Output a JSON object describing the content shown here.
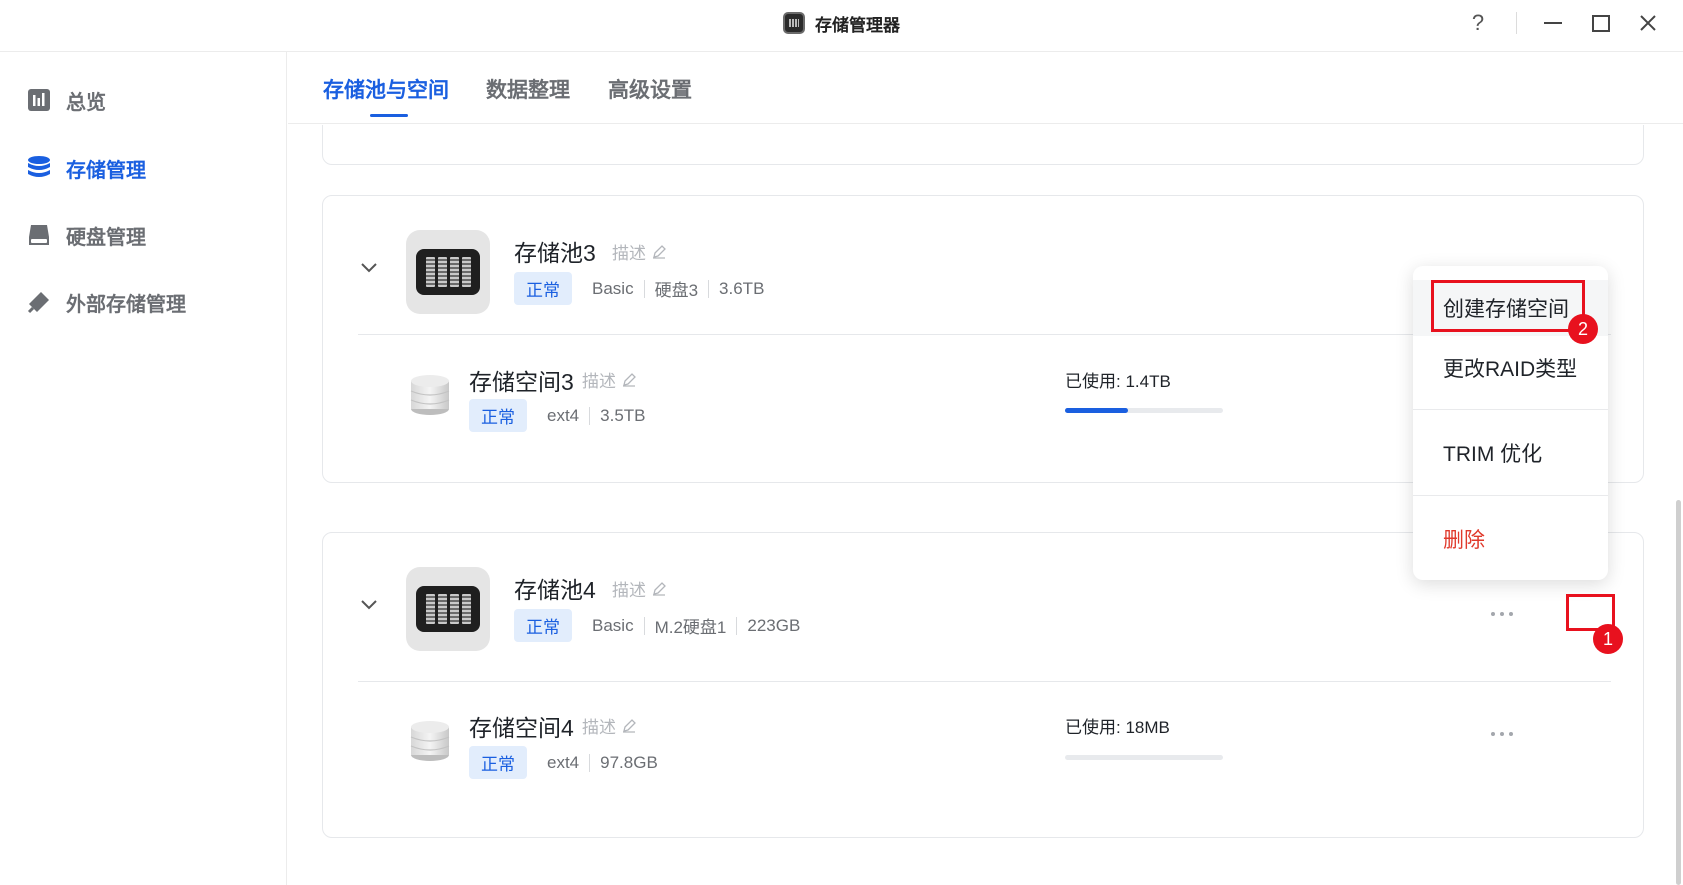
{
  "window": {
    "title": "存储管理器",
    "help": "?"
  },
  "sidebar": {
    "items": [
      {
        "label": "总览",
        "icon": "chart-icon"
      },
      {
        "label": "存储管理",
        "icon": "database-icon"
      },
      {
        "label": "硬盘管理",
        "icon": "harddisk-icon"
      },
      {
        "label": "外部存储管理",
        "icon": "usb-icon"
      }
    ],
    "active": "存储管理"
  },
  "tabs": {
    "items": [
      "存储池与空间",
      "数据整理",
      "高级设置"
    ],
    "active": "存储池与空间"
  },
  "pools": [
    {
      "name": "存储池3",
      "desc": "描述",
      "status": "正常",
      "raid": "Basic",
      "disk": "硬盘3",
      "size": "3.6TB",
      "volume": {
        "name": "存储空间3",
        "desc": "描述",
        "status": "正常",
        "fs": "ext4",
        "size": "3.5TB",
        "used_label": "已使用: 1.4TB",
        "used_fraction": 0.4
      }
    },
    {
      "name": "存储池4",
      "desc": "描述",
      "status": "正常",
      "raid": "Basic",
      "disk": "M.2硬盘1",
      "size": "223GB",
      "volume": {
        "name": "存储空间4",
        "desc": "描述",
        "status": "正常",
        "fs": "ext4",
        "size": "97.8GB",
        "used_label": "已使用: 18MB",
        "used_fraction": 0.0
      }
    }
  ],
  "menu": {
    "items": [
      "创建存储空间",
      "更改RAID类型",
      "TRIM 优化",
      "删除"
    ]
  },
  "annotations": {
    "step1": "1",
    "step2": "2"
  },
  "colors": {
    "accent": "#1a5fe0",
    "danger": "#e0392b",
    "annotation": "#e8111e"
  }
}
